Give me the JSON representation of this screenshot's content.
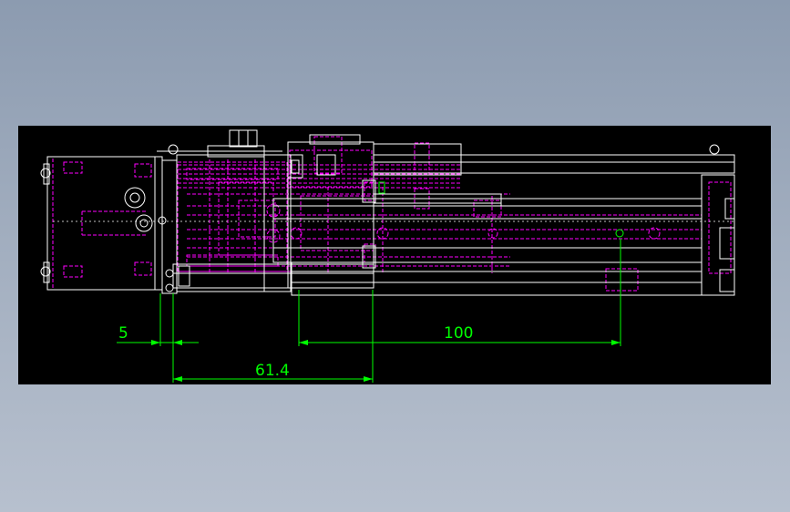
{
  "colors": {
    "background": "#95a2b6",
    "canvas": "#000000",
    "outline": "#ffffff",
    "hidden_lines": "#ff00ff",
    "dimension": "#00ff00",
    "centerline": "#ffffff"
  },
  "dimensions": {
    "d5": "5",
    "d100": "100",
    "d61_4": "61.4"
  }
}
